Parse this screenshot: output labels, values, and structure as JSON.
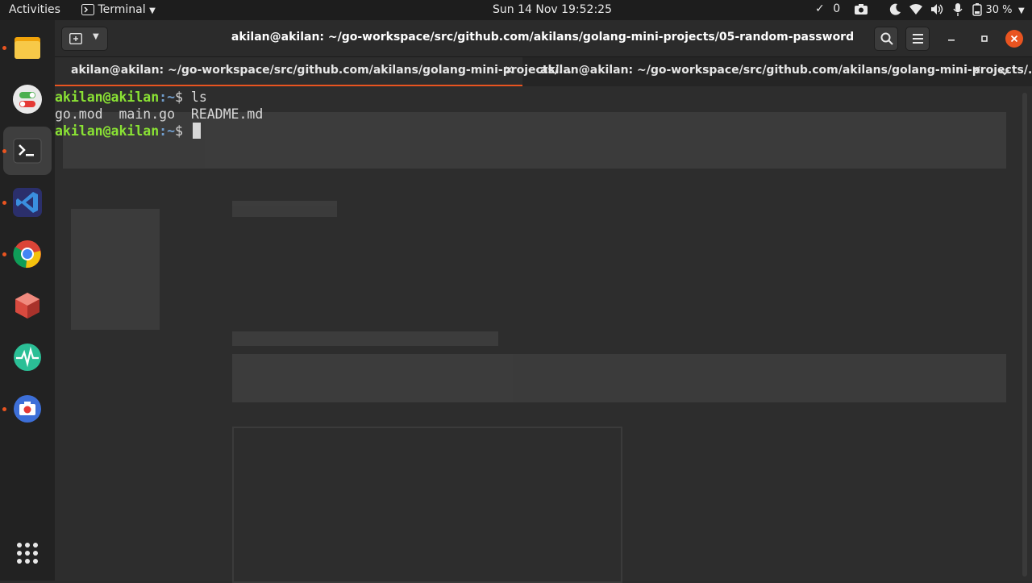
{
  "topbar": {
    "activities": "Activities",
    "app_menu": "Terminal",
    "clock": "Sun 14 Nov  19:52:25",
    "check_count": "0",
    "battery": "30 %"
  },
  "dock": {
    "apps": [
      "files-icon",
      "toggle-settings-icon",
      "terminal-icon",
      "vscode-icon",
      "chrome-icon",
      "package-icon",
      "system-monitor-icon",
      "screenshot-icon",
      "app-grid-icon"
    ]
  },
  "window": {
    "title": "akilan@akilan: ~/go-workspace/src/github.com/akilans/golang-mini-projects/05-random-password",
    "tabs": [
      {
        "label": "akilan@akilan: ~/go-workspace/src/github.com/akilans/golang-mini-projects/...",
        "close": "✕"
      },
      {
        "label": "akilan@akilan: ~/go-workspace/src/github.com/akilans/golang-mini-projects/...",
        "close": "✕"
      }
    ]
  },
  "terminal": {
    "prompt_user": "akilan@akilan",
    "prompt_path": ":~",
    "prompt_symbol": "$",
    "line1_cmd": " ls",
    "line2_output": "go.mod  main.go  README.md",
    "line3_cmd": " "
  },
  "colors": {
    "accent": "#e95420",
    "prompt_green": "#8ae234",
    "prompt_blue": "#729fcf",
    "terminal_bg": "#2d2d2d"
  }
}
